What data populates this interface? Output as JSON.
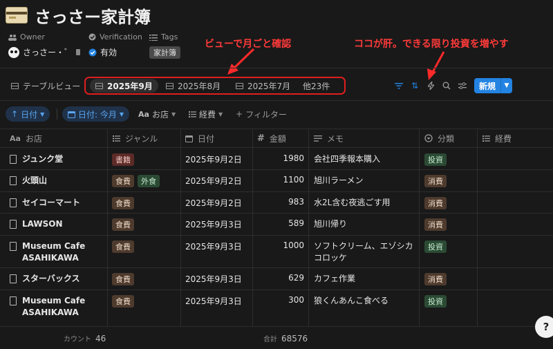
{
  "page": {
    "title": "さっさー家計簿"
  },
  "props": {
    "owner_label": "Owner",
    "owner_value": "さっさー・゛",
    "verification_label": "Verification",
    "verification_value": "有効",
    "tags_label": "Tags",
    "tags_value": "家計簿"
  },
  "annotations": {
    "left": "ビューで月ごと確認",
    "right": "ココが肝。できる限り投資を増やす"
  },
  "views": {
    "main_label": "テーブルビュー",
    "tabs": [
      "2025年9月",
      "2025年8月",
      "2025年7月"
    ],
    "more": "他23件",
    "new_label": "新規"
  },
  "filters": {
    "sort_chip": "日付",
    "date_chip": "日付: 今月",
    "store_chip": "お店",
    "expense_chip": "経費",
    "add_filter": "フィルター"
  },
  "table": {
    "columns": [
      "お店",
      "ジャンル",
      "日付",
      "金額",
      "メモ",
      "分類",
      "経費"
    ],
    "rows": [
      {
        "store": [
          "ジュンク堂"
        ],
        "genre": [
          {
            "text": "書籍",
            "style": "book"
          }
        ],
        "date": "2025年9月2日",
        "amount": "1980",
        "memo": [
          "会社四季報本購入"
        ],
        "cat": {
          "text": "投資",
          "style": "inv"
        }
      },
      {
        "store": [
          "火頭山"
        ],
        "genre": [
          {
            "text": "食費",
            "style": "food"
          },
          {
            "text": "外食",
            "style": "out"
          }
        ],
        "date": "2025年9月2日",
        "amount": "1100",
        "memo": [
          "旭川ラーメン"
        ],
        "cat": {
          "text": "消費",
          "style": "con"
        }
      },
      {
        "store": [
          "セイコーマート"
        ],
        "genre": [
          {
            "text": "食費",
            "style": "food"
          }
        ],
        "date": "2025年9月2日",
        "amount": "983",
        "memo": [
          "水2L含む夜逃ごす用"
        ],
        "cat": {
          "text": "消費",
          "style": "con"
        }
      },
      {
        "store": [
          "LAWSON"
        ],
        "genre": [
          {
            "text": "食費",
            "style": "food"
          }
        ],
        "date": "2025年9月3日",
        "amount": "589",
        "memo": [
          "旭川帰り"
        ],
        "cat": {
          "text": "消費",
          "style": "con"
        }
      },
      {
        "store": [
          "Museum Cafe",
          "ASAHIKAWA"
        ],
        "genre": [
          {
            "text": "食費",
            "style": "food"
          }
        ],
        "date": "2025年9月3日",
        "amount": "1000",
        "memo": [
          "ソフトクリーム、エゾシカ",
          "コロッケ"
        ],
        "cat": {
          "text": "投資",
          "style": "inv"
        }
      },
      {
        "store": [
          "スターバックス"
        ],
        "genre": [
          {
            "text": "食費",
            "style": "food"
          }
        ],
        "date": "2025年9月3日",
        "amount": "629",
        "memo": [
          "カフェ作業"
        ],
        "cat": {
          "text": "消費",
          "style": "con"
        }
      },
      {
        "store": [
          "Museum Cafe",
          "ASAHIKAWA"
        ],
        "genre": [
          {
            "text": "食費",
            "style": "food"
          }
        ],
        "date": "2025年9月3日",
        "amount": "300",
        "memo": [
          "狼くんあんこ食べる"
        ],
        "cat": {
          "text": "投資",
          "style": "inv"
        }
      }
    ]
  },
  "footer": {
    "count_label": "カウント",
    "count_value": "46",
    "sum_label": "合計",
    "sum_value": "68576"
  },
  "help": {
    "label": "?"
  },
  "colors": {
    "accent": "#2383e2",
    "annotation": "#ff3a3a",
    "background": "#191919"
  }
}
